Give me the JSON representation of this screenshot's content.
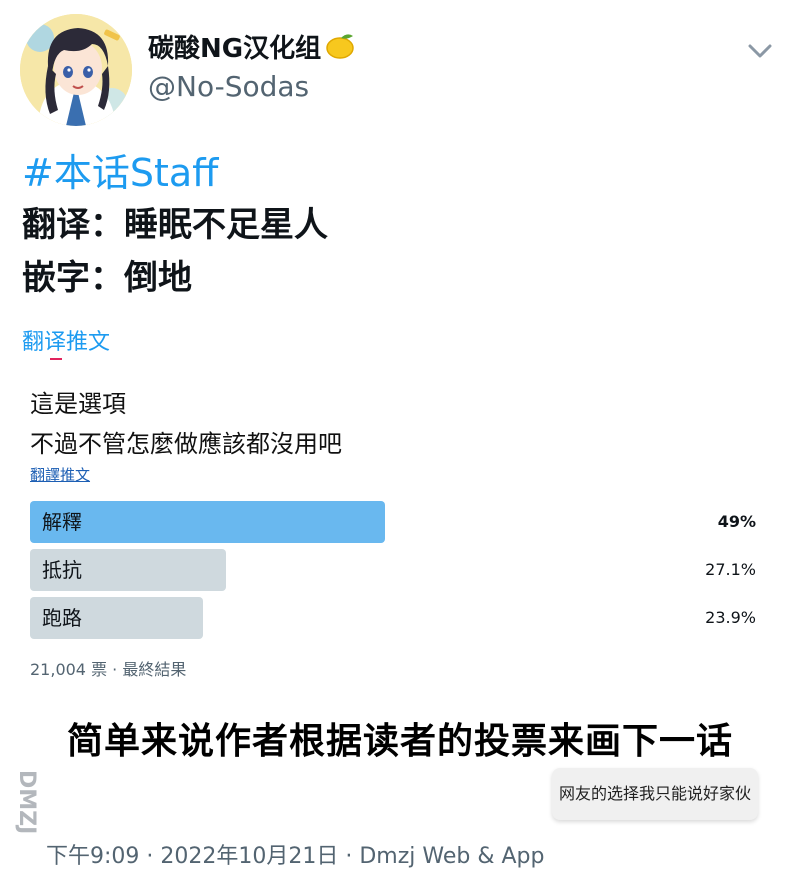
{
  "header": {
    "display_name": "碳酸NG汉化组",
    "handle": "@No-Sodas"
  },
  "tweet": {
    "hashtag": "#本话Staff",
    "line1": "翻译：睡眠不足星人",
    "line2": "嵌字：倒地",
    "translate_label": "翻译推文"
  },
  "poll": {
    "text_line1": "這是選項",
    "text_line2": "不過不管怎麼做應該都沒用吧",
    "translate_label": "翻譯推文",
    "options": [
      {
        "label": "解釋",
        "percent_text": "49%",
        "fraction": 0.49,
        "winner": true,
        "color": "#69b8ef"
      },
      {
        "label": "抵抗",
        "percent_text": "27.1%",
        "fraction": 0.271,
        "winner": false,
        "color": "#cfd9de"
      },
      {
        "label": "跑路",
        "percent_text": "23.9%",
        "fraction": 0.239,
        "winner": false,
        "color": "#cfd9de"
      }
    ],
    "footer": "21,004 票 · 最終結果"
  },
  "caption": "简单来说作者根据读者的投票来画下一话",
  "bubble": "网友的选择我只能说好家伙",
  "watermark": "DMZJ.com",
  "timestamp": "下午9:09 · 2022年10月21日 · Dmzj Web & App",
  "colors": {
    "accent": "#1d9bf0",
    "poll_winner": "#69b8ef",
    "poll_other": "#cfd9de",
    "secondary_text": "#536471"
  },
  "icons": {
    "more": "chevron-down-icon",
    "emoji": "lemon-icon"
  }
}
